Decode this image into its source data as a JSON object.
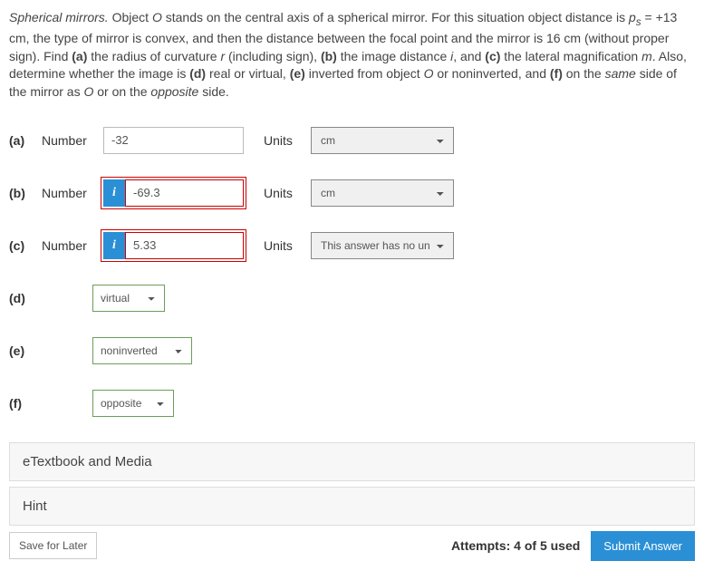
{
  "problem": {
    "lead": "Spherical mirrors.",
    "t1": " Object ",
    "obj": "O",
    "t2": " stands on the central axis of a spherical mirror. For this situation object distance is ",
    "ps": "p",
    "psub": "s",
    "t3": " = +13 cm, the type of mirror is convex, and then the distance between the focal point and the mirror is 16 cm (without proper sign). Find ",
    "a": "(a)",
    "t4": " the radius of curvature ",
    "rvar": "r",
    "t5": " (including sign), ",
    "b": "(b)",
    "t6": " the image distance ",
    "ivar": "i",
    "t7": ", and ",
    "c": "(c)",
    "t8": " the lateral magnification ",
    "mvar": "m",
    "t9": ". Also, determine whether the image is ",
    "d": "(d)",
    "t10": " real or virtual, ",
    "e": "(e)",
    "t11": " inverted from object ",
    "obj2": "O",
    "t12": " or noninverted, and ",
    "f": "(f)",
    "t13": " on the ",
    "same": "same",
    "t14": " side of the mirror as ",
    "obj3": "O",
    "t15": " or on the ",
    "opp": "opposite",
    "t16": " side."
  },
  "labels": {
    "number": "Number",
    "units": "Units",
    "i_badge": "i"
  },
  "parts": {
    "a": {
      "label": "(a)",
      "value": "-32",
      "units": "cm"
    },
    "b": {
      "label": "(b)",
      "value": "-69.3",
      "units": "cm"
    },
    "c": {
      "label": "(c)",
      "value": "5.33",
      "units": "This answer has no units"
    },
    "d": {
      "label": "(d)",
      "selected": "virtual"
    },
    "e": {
      "label": "(e)",
      "selected": "noninverted"
    },
    "f": {
      "label": "(f)",
      "selected": "opposite"
    }
  },
  "bars": {
    "etextbook": "eTextbook and Media",
    "hint": "Hint"
  },
  "footer": {
    "save": "Save for Later",
    "attempts": "Attempts: 4 of 5 used",
    "submit": "Submit Answer"
  }
}
